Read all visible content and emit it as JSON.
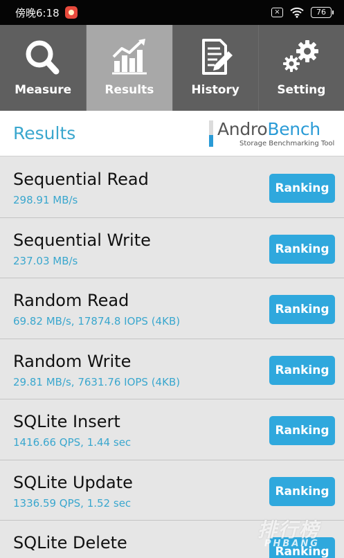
{
  "status_bar": {
    "time": "傍晚6:18",
    "battery": "76"
  },
  "tabs": [
    {
      "label": "Measure",
      "icon": "magnifier-icon",
      "active": false
    },
    {
      "label": "Results",
      "icon": "chart-icon",
      "active": true
    },
    {
      "label": "History",
      "icon": "document-icon",
      "active": false
    },
    {
      "label": "Setting",
      "icon": "gears-icon",
      "active": false
    }
  ],
  "header": {
    "title": "Results",
    "logo_name_part1": "Andro",
    "logo_name_part2": "Bench",
    "logo_subtitle": "Storage Benchmarking Tool"
  },
  "results": [
    {
      "name": "Sequential Read",
      "value": "298.91 MB/s",
      "button": "Ranking"
    },
    {
      "name": "Sequential Write",
      "value": "237.03 MB/s",
      "button": "Ranking"
    },
    {
      "name": "Random Read",
      "value": "69.82 MB/s, 17874.8 IOPS (4KB)",
      "button": "Ranking"
    },
    {
      "name": "Random Write",
      "value": "29.81 MB/s, 7631.76 IOPS (4KB)",
      "button": "Ranking"
    },
    {
      "name": "SQLite Insert",
      "value": "1416.66 QPS, 1.44 sec",
      "button": "Ranking"
    },
    {
      "name": "SQLite Update",
      "value": "1336.59 QPS, 1.52 sec",
      "button": "Ranking"
    },
    {
      "name": "SQLite Delete",
      "value": "",
      "button": "Ranking"
    }
  ],
  "watermark": {
    "main": "排行榜",
    "sub": "PHBANG"
  },
  "colors": {
    "accent": "#3aa7ce",
    "button": "#2fa8dd",
    "tabbar": "#5f5f5f",
    "tab_active": "#a8a8a8",
    "list_bg": "#e6e6e6"
  }
}
